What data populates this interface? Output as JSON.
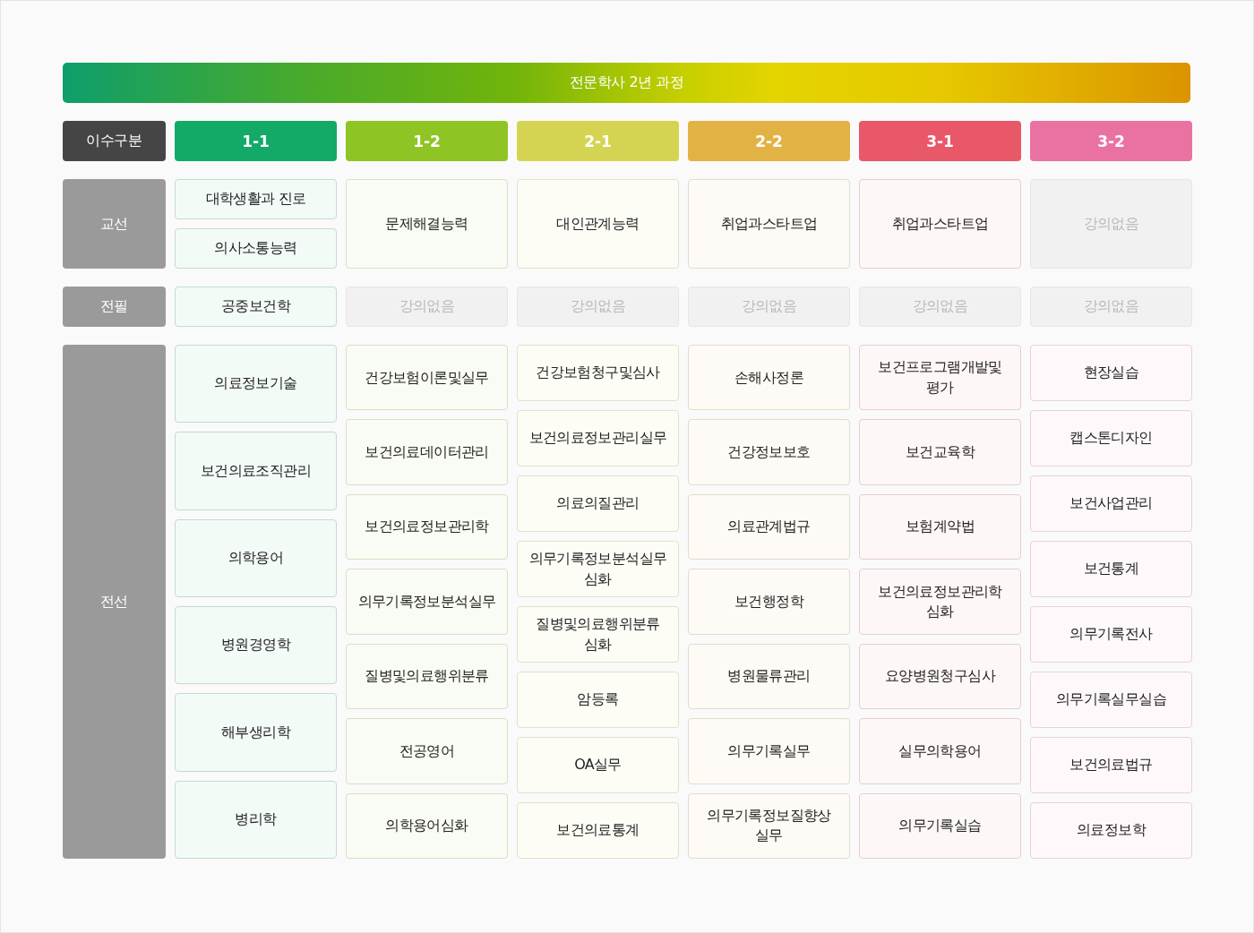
{
  "banner": {
    "title": "전문학사 2년 과정"
  },
  "header": {
    "label": "이수구분"
  },
  "semesters": [
    {
      "label": "1-1",
      "color": "#13aa68"
    },
    {
      "label": "1-2",
      "color": "#8fc425"
    },
    {
      "label": "2-1",
      "color": "#d4d452"
    },
    {
      "label": "2-2",
      "color": "#e3b245"
    },
    {
      "label": "3-1",
      "color": "#e85868"
    },
    {
      "label": "3-2",
      "color": "#ea72a3"
    }
  ],
  "categories": [
    {
      "label": "교선",
      "semesters": [
        {
          "courses": [
            {
              "kind": "course",
              "name": "대학생활과 진로"
            },
            {
              "kind": "course",
              "name": "의사소통능력"
            }
          ]
        },
        {
          "courses": [
            {
              "kind": "course",
              "name": "문제해결능력"
            }
          ]
        },
        {
          "courses": [
            {
              "kind": "course",
              "name": "대인관계능력"
            }
          ]
        },
        {
          "courses": [
            {
              "kind": "course",
              "name": "취업과스타트업"
            }
          ]
        },
        {
          "courses": [
            {
              "kind": "course",
              "name": "취업과스타트업"
            }
          ]
        },
        {
          "courses": [
            {
              "kind": "none",
              "name": "강의없음"
            }
          ]
        }
      ]
    },
    {
      "label": "전필",
      "semesters": [
        {
          "courses": [
            {
              "kind": "course",
              "name": "공중보건학"
            }
          ]
        },
        {
          "courses": [
            {
              "kind": "none",
              "name": "강의없음"
            }
          ]
        },
        {
          "courses": [
            {
              "kind": "none",
              "name": "강의없음"
            }
          ]
        },
        {
          "courses": [
            {
              "kind": "none",
              "name": "강의없음"
            }
          ]
        },
        {
          "courses": [
            {
              "kind": "none",
              "name": "강의없음"
            }
          ]
        },
        {
          "courses": [
            {
              "kind": "none",
              "name": "강의없음"
            }
          ]
        }
      ]
    },
    {
      "label": "전선",
      "semesters": [
        {
          "courses": [
            {
              "kind": "course",
              "name": "의료정보기술"
            },
            {
              "kind": "course",
              "name": "보건의료조직관리"
            },
            {
              "kind": "course",
              "name": "의학용어"
            },
            {
              "kind": "course",
              "name": "병원경영학"
            },
            {
              "kind": "course",
              "name": "해부생리학"
            },
            {
              "kind": "course",
              "name": "병리학"
            }
          ]
        },
        {
          "courses": [
            {
              "kind": "course",
              "name": "건강보험이론및실무"
            },
            {
              "kind": "course",
              "name": "보건의료데이터관리"
            },
            {
              "kind": "course",
              "name": "보건의료정보관리학"
            },
            {
              "kind": "course",
              "name": "의무기록정보분석실무"
            },
            {
              "kind": "course",
              "name": "질병및의료행위분류"
            },
            {
              "kind": "course",
              "name": "전공영어"
            },
            {
              "kind": "course",
              "name": "의학용어심화"
            }
          ]
        },
        {
          "courses": [
            {
              "kind": "course",
              "name": "건강보험청구및심사"
            },
            {
              "kind": "course",
              "name": "보건의료정보관리실무"
            },
            {
              "kind": "course",
              "name": "의료의질관리"
            },
            {
              "kind": "course",
              "name": "의무기록정보분석실무 심화"
            },
            {
              "kind": "course",
              "name": "질병및의료행위분류 심화"
            },
            {
              "kind": "course",
              "name": "암등록"
            },
            {
              "kind": "course",
              "name": "OA실무"
            },
            {
              "kind": "course",
              "name": "보건의료통계"
            }
          ]
        },
        {
          "courses": [
            {
              "kind": "course",
              "name": "손해사정론"
            },
            {
              "kind": "course",
              "name": "건강정보보호"
            },
            {
              "kind": "course",
              "name": "의료관계법규"
            },
            {
              "kind": "course",
              "name": "보건행정학"
            },
            {
              "kind": "course",
              "name": "병원물류관리"
            },
            {
              "kind": "course",
              "name": "의무기록실무"
            },
            {
              "kind": "course",
              "name": "의무기록정보질향상 실무"
            }
          ]
        },
        {
          "courses": [
            {
              "kind": "course",
              "name": "보건프로그램개발및 평가"
            },
            {
              "kind": "course",
              "name": "보건교육학"
            },
            {
              "kind": "course",
              "name": "보험계약법"
            },
            {
              "kind": "course",
              "name": "보건의료정보관리학 심화"
            },
            {
              "kind": "course",
              "name": "요양병원청구심사"
            },
            {
              "kind": "course",
              "name": "실무의학용어"
            },
            {
              "kind": "course",
              "name": "의무기록실습"
            }
          ]
        },
        {
          "courses": [
            {
              "kind": "course",
              "name": "현장실습"
            },
            {
              "kind": "course",
              "name": "캡스톤디자인"
            },
            {
              "kind": "course",
              "name": "보건사업관리"
            },
            {
              "kind": "course",
              "name": "보건통계"
            },
            {
              "kind": "course",
              "name": "의무기록전사"
            },
            {
              "kind": "course",
              "name": "의무기록실무실습"
            },
            {
              "kind": "course",
              "name": "보건의료법규"
            },
            {
              "kind": "course",
              "name": "의료정보학"
            }
          ]
        }
      ]
    }
  ]
}
